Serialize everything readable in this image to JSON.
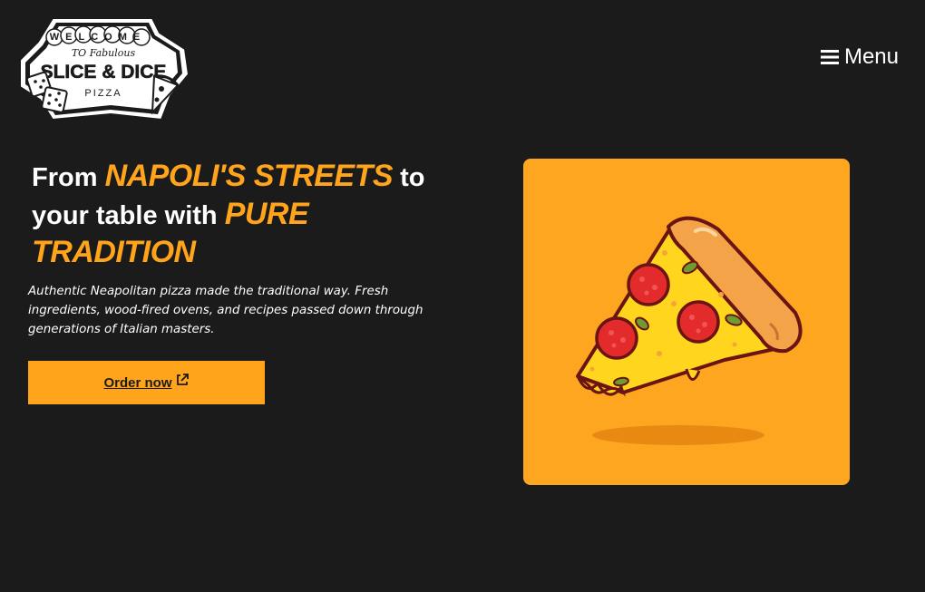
{
  "logo": {
    "line1": "WELCOME",
    "line2": "TO Fabulous",
    "line3": "SLICE & DICE",
    "line4": "PIZZA"
  },
  "nav": {
    "menu_label": "Menu",
    "menu_icon": "hamburger-icon"
  },
  "hero": {
    "headline": {
      "part1": "From ",
      "accent1": "NAPOLI'S STREETS",
      "part2": " to your table with ",
      "accent2": "PURE TRADITION"
    },
    "description": "Authentic Neapolitan pizza made the traditional way. Fresh ingredients, wood-fired ovens, and recipes passed down through generations of Italian masters.",
    "cta_label": "Order now",
    "cta_icon": "external-link-icon",
    "image": "pizza-slice-illustration"
  },
  "colors": {
    "background": "#1b1b1b",
    "accent": "#ffa41b",
    "image_bg": "#ffa620"
  }
}
